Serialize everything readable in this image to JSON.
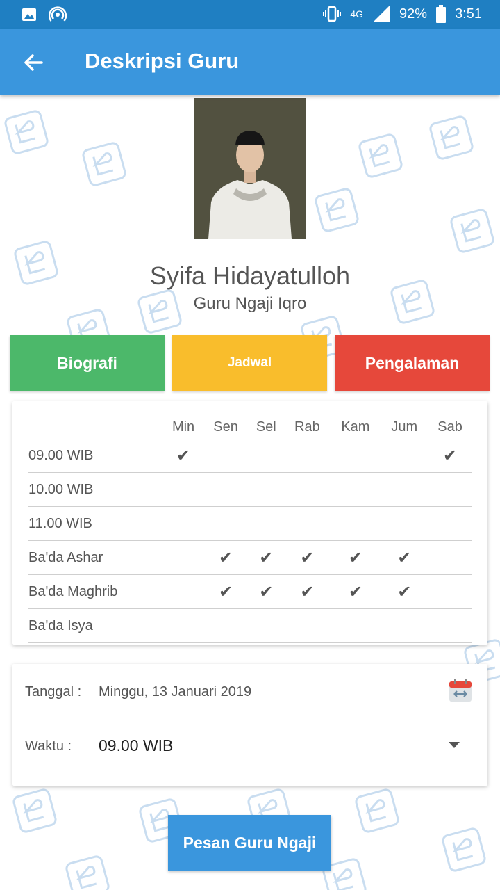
{
  "status_bar": {
    "network": "4G",
    "battery": "92%",
    "time": "3:51"
  },
  "appbar": {
    "title": "Deskripsi Guru",
    "back_icon": "arrow-left"
  },
  "teacher": {
    "name": "Syifa Hidayatulloh",
    "role": "Guru Ngaji Iqro"
  },
  "tabs": [
    {
      "label": "Biografi",
      "color": "#4cb86a"
    },
    {
      "label": "Jadwal",
      "color": "#f9bd2c"
    },
    {
      "label": "Pengalaman",
      "color": "#e6483b"
    }
  ],
  "schedule": {
    "days": [
      "Min",
      "Sen",
      "Sel",
      "Rab",
      "Kam",
      "Jum",
      "Sab"
    ],
    "rows": [
      {
        "time": "09.00 WIB",
        "checks": [
          true,
          false,
          false,
          false,
          false,
          false,
          true
        ]
      },
      {
        "time": "10.00 WIB",
        "checks": [
          false,
          false,
          false,
          false,
          false,
          false,
          false
        ]
      },
      {
        "time": "11.00 WIB",
        "checks": [
          false,
          false,
          false,
          false,
          false,
          false,
          false
        ]
      },
      {
        "time": "Ba'da Ashar",
        "checks": [
          false,
          true,
          true,
          true,
          true,
          true,
          false
        ]
      },
      {
        "time": "Ba'da Maghrib",
        "checks": [
          false,
          true,
          true,
          true,
          true,
          true,
          false
        ]
      },
      {
        "time": "Ba'da Isya",
        "checks": [
          false,
          false,
          false,
          false,
          false,
          false,
          false
        ]
      }
    ],
    "check_mark": "✔"
  },
  "booking": {
    "date_label": "Tanggal :",
    "date_value": "Minggu, 13 Januari 2019",
    "time_label": "Waktu :",
    "time_value": "09.00 WIB"
  },
  "order_button": {
    "label": "Pesan Guru Ngaji",
    "color": "#3a96dd"
  }
}
